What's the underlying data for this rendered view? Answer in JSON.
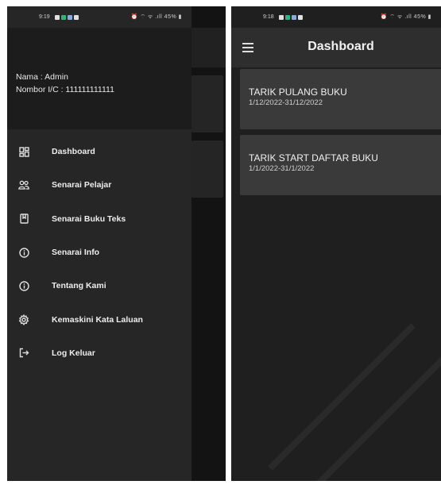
{
  "left_screen": {
    "status": {
      "time": "9:19",
      "system": "⏰ ⌔ ᯤ .ıll 45% ▮"
    },
    "drawer": {
      "user_name": "Nama : Admin",
      "user_ic": "Nombor I/C : 111111111111",
      "items": [
        {
          "label": "Dashboard",
          "icon": "dashboard-icon"
        },
        {
          "label": "Senarai Pelajar",
          "icon": "people-icon"
        },
        {
          "label": "Senarai Buku Teks",
          "icon": "book-icon"
        },
        {
          "label": "Senarai Info",
          "icon": "info-icon"
        },
        {
          "label": "Tentang Kami",
          "icon": "info-icon"
        },
        {
          "label": "Kemaskini Kata Laluan",
          "icon": "gear-icon"
        },
        {
          "label": "Log Keluar",
          "icon": "logout-icon"
        }
      ]
    }
  },
  "right_screen": {
    "status": {
      "time": "9:18",
      "system": "⏰ ⌔ ᯤ .ıll 45% ▮"
    },
    "appbar": {
      "title": "Dashboard",
      "menu_icon": "hamburger-menu-icon"
    },
    "cards": [
      {
        "title": "TARIK PULANG BUKU",
        "dates": "1/12/2022-31/12/2022"
      },
      {
        "title": "TARIK START DAFTAR BUKU",
        "dates": "1/1/2022-31/1/2022"
      }
    ]
  },
  "colors": {
    "background": "#1e1e1e",
    "drawer": "#262626",
    "appbar": "#2e2e2e",
    "card": "#3a3a3a",
    "text": "#ededed"
  }
}
